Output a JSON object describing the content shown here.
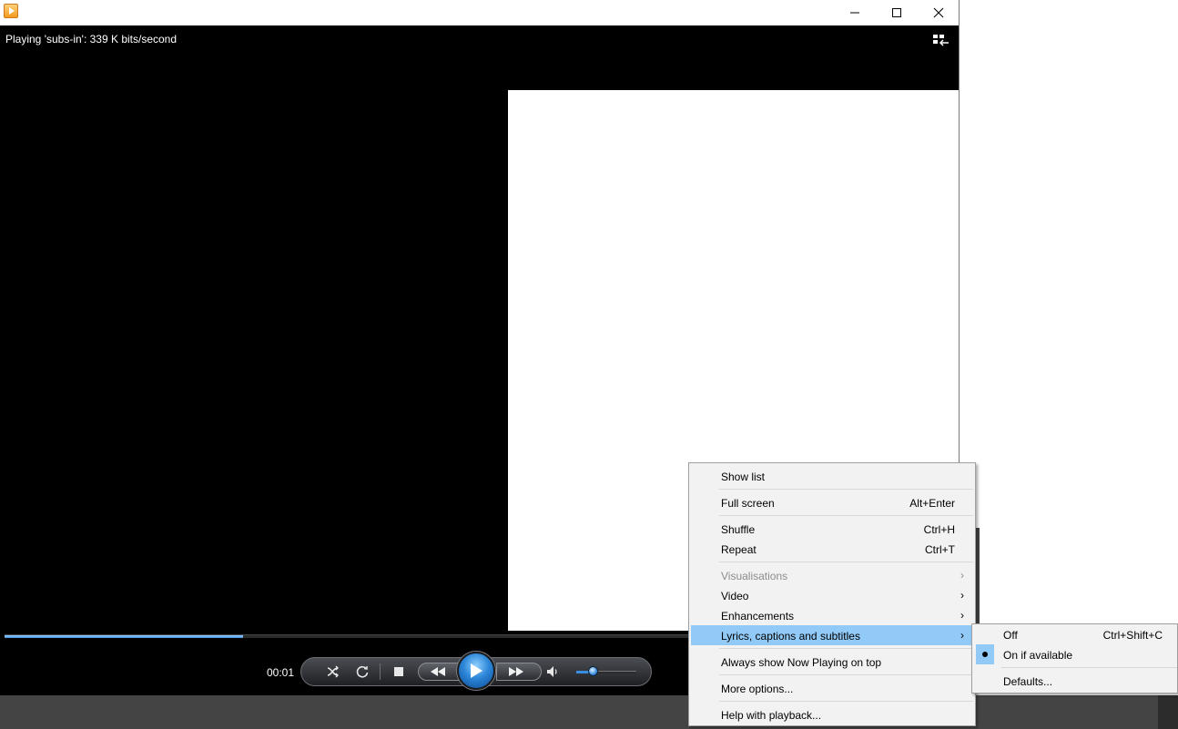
{
  "window": {
    "status_text": "Playing 'subs-in': 339 K bits/second"
  },
  "player": {
    "time": "00:01",
    "seek_progress": 0.25,
    "volume_level": 0.28
  },
  "context_menu": {
    "items": [
      {
        "label": "Show list",
        "shortcut": ""
      },
      {
        "label": "Full screen",
        "shortcut": "Alt+Enter"
      },
      {
        "label": "Shuffle",
        "shortcut": "Ctrl+H"
      },
      {
        "label": "Repeat",
        "shortcut": "Ctrl+T"
      },
      {
        "label": "Visualisations",
        "shortcut": "",
        "disabled": true,
        "submenu": true
      },
      {
        "label": "Video",
        "shortcut": "",
        "submenu": true
      },
      {
        "label": "Enhancements",
        "shortcut": "",
        "submenu": true
      },
      {
        "label": "Lyrics, captions and subtitles",
        "shortcut": "",
        "submenu": true,
        "highlighted": true
      },
      {
        "label": "Always show Now Playing on top",
        "shortcut": ""
      },
      {
        "label": "More options...",
        "shortcut": ""
      },
      {
        "label": "Help with playback...",
        "shortcut": ""
      }
    ]
  },
  "submenu": {
    "items": [
      {
        "label": "Off",
        "shortcut": "Ctrl+Shift+C",
        "checked": false
      },
      {
        "label": "On if available",
        "shortcut": "",
        "checked": true
      },
      {
        "label": "Defaults...",
        "shortcut": "",
        "checked": false
      }
    ]
  },
  "colors": {
    "highlight": "#91c9f7",
    "accent": "#3b8fe0"
  }
}
